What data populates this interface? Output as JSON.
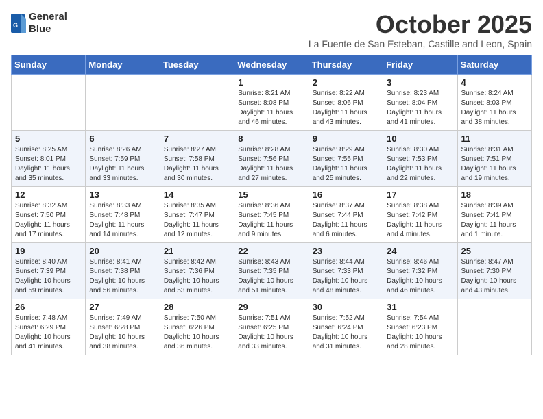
{
  "header": {
    "logo_line1": "General",
    "logo_line2": "Blue",
    "month_title": "October 2025",
    "location": "La Fuente de San Esteban, Castille and Leon, Spain"
  },
  "days_of_week": [
    "Sunday",
    "Monday",
    "Tuesday",
    "Wednesday",
    "Thursday",
    "Friday",
    "Saturday"
  ],
  "weeks": [
    [
      {
        "day": "",
        "info": ""
      },
      {
        "day": "",
        "info": ""
      },
      {
        "day": "",
        "info": ""
      },
      {
        "day": "1",
        "info": "Sunrise: 8:21 AM\nSunset: 8:08 PM\nDaylight: 11 hours and 46 minutes."
      },
      {
        "day": "2",
        "info": "Sunrise: 8:22 AM\nSunset: 8:06 PM\nDaylight: 11 hours and 43 minutes."
      },
      {
        "day": "3",
        "info": "Sunrise: 8:23 AM\nSunset: 8:04 PM\nDaylight: 11 hours and 41 minutes."
      },
      {
        "day": "4",
        "info": "Sunrise: 8:24 AM\nSunset: 8:03 PM\nDaylight: 11 hours and 38 minutes."
      }
    ],
    [
      {
        "day": "5",
        "info": "Sunrise: 8:25 AM\nSunset: 8:01 PM\nDaylight: 11 hours and 35 minutes."
      },
      {
        "day": "6",
        "info": "Sunrise: 8:26 AM\nSunset: 7:59 PM\nDaylight: 11 hours and 33 minutes."
      },
      {
        "day": "7",
        "info": "Sunrise: 8:27 AM\nSunset: 7:58 PM\nDaylight: 11 hours and 30 minutes."
      },
      {
        "day": "8",
        "info": "Sunrise: 8:28 AM\nSunset: 7:56 PM\nDaylight: 11 hours and 27 minutes."
      },
      {
        "day": "9",
        "info": "Sunrise: 8:29 AM\nSunset: 7:55 PM\nDaylight: 11 hours and 25 minutes."
      },
      {
        "day": "10",
        "info": "Sunrise: 8:30 AM\nSunset: 7:53 PM\nDaylight: 11 hours and 22 minutes."
      },
      {
        "day": "11",
        "info": "Sunrise: 8:31 AM\nSunset: 7:51 PM\nDaylight: 11 hours and 19 minutes."
      }
    ],
    [
      {
        "day": "12",
        "info": "Sunrise: 8:32 AM\nSunset: 7:50 PM\nDaylight: 11 hours and 17 minutes."
      },
      {
        "day": "13",
        "info": "Sunrise: 8:33 AM\nSunset: 7:48 PM\nDaylight: 11 hours and 14 minutes."
      },
      {
        "day": "14",
        "info": "Sunrise: 8:35 AM\nSunset: 7:47 PM\nDaylight: 11 hours and 12 minutes."
      },
      {
        "day": "15",
        "info": "Sunrise: 8:36 AM\nSunset: 7:45 PM\nDaylight: 11 hours and 9 minutes."
      },
      {
        "day": "16",
        "info": "Sunrise: 8:37 AM\nSunset: 7:44 PM\nDaylight: 11 hours and 6 minutes."
      },
      {
        "day": "17",
        "info": "Sunrise: 8:38 AM\nSunset: 7:42 PM\nDaylight: 11 hours and 4 minutes."
      },
      {
        "day": "18",
        "info": "Sunrise: 8:39 AM\nSunset: 7:41 PM\nDaylight: 11 hours and 1 minute."
      }
    ],
    [
      {
        "day": "19",
        "info": "Sunrise: 8:40 AM\nSunset: 7:39 PM\nDaylight: 10 hours and 59 minutes."
      },
      {
        "day": "20",
        "info": "Sunrise: 8:41 AM\nSunset: 7:38 PM\nDaylight: 10 hours and 56 minutes."
      },
      {
        "day": "21",
        "info": "Sunrise: 8:42 AM\nSunset: 7:36 PM\nDaylight: 10 hours and 53 minutes."
      },
      {
        "day": "22",
        "info": "Sunrise: 8:43 AM\nSunset: 7:35 PM\nDaylight: 10 hours and 51 minutes."
      },
      {
        "day": "23",
        "info": "Sunrise: 8:44 AM\nSunset: 7:33 PM\nDaylight: 10 hours and 48 minutes."
      },
      {
        "day": "24",
        "info": "Sunrise: 8:46 AM\nSunset: 7:32 PM\nDaylight: 10 hours and 46 minutes."
      },
      {
        "day": "25",
        "info": "Sunrise: 8:47 AM\nSunset: 7:30 PM\nDaylight: 10 hours and 43 minutes."
      }
    ],
    [
      {
        "day": "26",
        "info": "Sunrise: 7:48 AM\nSunset: 6:29 PM\nDaylight: 10 hours and 41 minutes."
      },
      {
        "day": "27",
        "info": "Sunrise: 7:49 AM\nSunset: 6:28 PM\nDaylight: 10 hours and 38 minutes."
      },
      {
        "day": "28",
        "info": "Sunrise: 7:50 AM\nSunset: 6:26 PM\nDaylight: 10 hours and 36 minutes."
      },
      {
        "day": "29",
        "info": "Sunrise: 7:51 AM\nSunset: 6:25 PM\nDaylight: 10 hours and 33 minutes."
      },
      {
        "day": "30",
        "info": "Sunrise: 7:52 AM\nSunset: 6:24 PM\nDaylight: 10 hours and 31 minutes."
      },
      {
        "day": "31",
        "info": "Sunrise: 7:54 AM\nSunset: 6:23 PM\nDaylight: 10 hours and 28 minutes."
      },
      {
        "day": "",
        "info": ""
      }
    ]
  ]
}
